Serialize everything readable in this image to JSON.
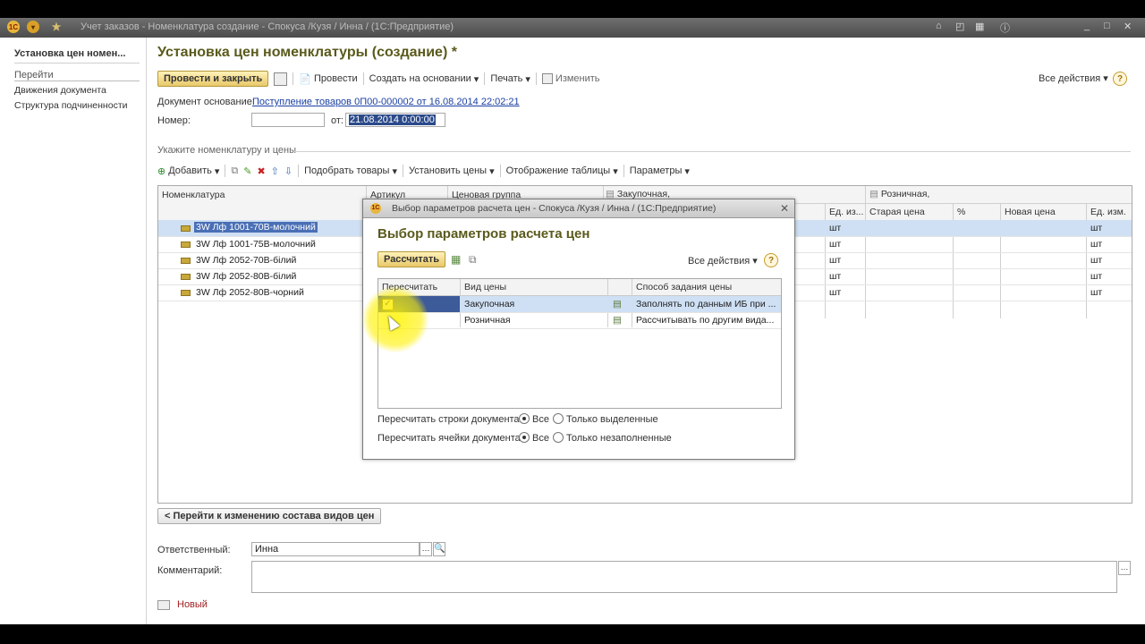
{
  "window": {
    "title": "Учет заказов - Номенклатура создание - Спокуса /Кузя / Инна / (1С:Предприятие)"
  },
  "sidebar": {
    "title": "Установка цен номен...",
    "group": "Перейти",
    "links": [
      "Движения документа",
      "Структура подчиненности"
    ]
  },
  "form": {
    "title": "Установка цен номенклатуры (создание) *",
    "toolbar": {
      "post_close": "Провести и закрыть",
      "post": "Провести",
      "create_based": "Создать на основании",
      "print": "Печать",
      "edit": "Изменить",
      "all_actions": "Все действия"
    },
    "basis_label": "Документ основание:",
    "basis_link": "Поступление товаров 0П00-000002 от 16.08.2014 22:02:21",
    "number_label": "Номер:",
    "number_value": "",
    "date_label": "от:",
    "date_value": "21.08.2014  0:00:00",
    "section_label": "Укажите номенклатуру и цены",
    "grid_toolbar": {
      "add": "Добавить",
      "pick": "Подобрать товары",
      "set_prices": "Установить цены",
      "display": "Отображение таблицы",
      "params": "Параметры"
    },
    "grid": {
      "headers": {
        "item": "Номенклатура",
        "article": "Артикул",
        "price_group": "Ценовая группа",
        "purchase": "Закупочная,",
        "retail": "Розничная,",
        "unit": "Ед. из...",
        "old_price": "Старая цена",
        "percent": "%",
        "new_price": "Новая цена",
        "unit2": "Ед. изм."
      },
      "rows": [
        {
          "item": "3W Лф 1001-70В-молочний",
          "unit": "шт",
          "unit2": "шт"
        },
        {
          "item": "3W Лф 1001-75В-молочний",
          "unit": "шт",
          "unit2": "шт"
        },
        {
          "item": "3W Лф 2052-70В-білий",
          "unit": "шт",
          "unit2": "шт"
        },
        {
          "item": "3W Лф 2052-80В-білий",
          "unit": "шт",
          "unit2": "шт"
        },
        {
          "item": "3W Лф 2052-80В-чорний",
          "unit": "шт",
          "unit2": "шт"
        }
      ]
    },
    "back_button": "< Перейти к изменению состава видов цен",
    "responsible_label": "Ответственный:",
    "responsible_value": "Инна",
    "comment_label": "Комментарий:",
    "comment_value": "",
    "status": "Новый"
  },
  "dialog": {
    "window_title": "Выбор параметров расчета цен - Спокуса /Кузя / Инна / (1С:Предприятие)",
    "heading": "Выбор параметров расчета цен",
    "calc_button": "Рассчитать",
    "all_actions": "Все действия",
    "grid": {
      "headers": {
        "recalc": "Пересчитать",
        "price_type": "Вид цены",
        "method": "Способ задания цены"
      },
      "rows": [
        {
          "checked": true,
          "price_type": "Закупочная",
          "method": "Заполнять по данным ИБ при ..."
        },
        {
          "checked": false,
          "price_type": "Розничная",
          "method": "Рассчитывать по другим вида..."
        }
      ]
    },
    "recalc_rows_label": "Пересчитать строки документа:",
    "recalc_rows_options": [
      "Все",
      "Только выделенные"
    ],
    "recalc_rows_selected": "Все",
    "recalc_cells_label": "Пересчитать ячейки документа:",
    "recalc_cells_options": [
      "Все",
      "Только незаполненные"
    ],
    "recalc_cells_selected": "Все"
  }
}
